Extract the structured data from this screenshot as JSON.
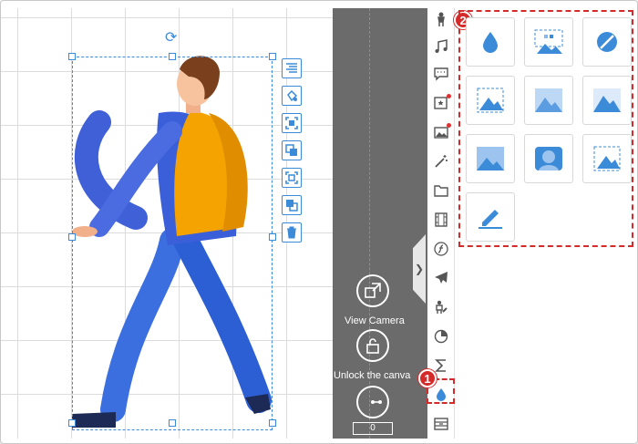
{
  "colors": {
    "accent": "#3c8bd9",
    "callout": "#d42a2a",
    "dark_panel": "#6b6b6b"
  },
  "canvas": {
    "figure": "walking-man-character",
    "object_toolbar": [
      {
        "name": "align-icon"
      },
      {
        "name": "fill-color-icon"
      },
      {
        "name": "crop-icon"
      },
      {
        "name": "copy-style-icon"
      },
      {
        "name": "fit-icon"
      },
      {
        "name": "layer-icon"
      },
      {
        "name": "delete-icon"
      }
    ]
  },
  "camera_panel": {
    "view_camera_label": "View Camera",
    "unlock_canvas_label": "Unlock the canva",
    "counter_value": "0"
  },
  "sidebar": {
    "items": [
      {
        "name": "character-icon"
      },
      {
        "name": "music-icon"
      },
      {
        "name": "speech-bubble-icon"
      },
      {
        "name": "sticker-icon"
      },
      {
        "name": "image-icon"
      },
      {
        "name": "magic-wand-icon"
      },
      {
        "name": "folder-icon"
      },
      {
        "name": "film-icon"
      },
      {
        "name": "formula-icon"
      },
      {
        "name": "airplane-icon"
      },
      {
        "name": "edit-person-icon"
      },
      {
        "name": "pie-chart-icon"
      },
      {
        "name": "sigma-icon"
      },
      {
        "name": "water-drop-icon"
      },
      {
        "name": "archive-icon"
      }
    ],
    "active_index": 13
  },
  "callouts": {
    "first": "1",
    "second": "2"
  },
  "effects_panel": {
    "effects": [
      {
        "name": "water-drop-effect-icon"
      },
      {
        "name": "mosaic-selection-effect-icon"
      },
      {
        "name": "no-fill-effect-icon"
      },
      {
        "name": "selection-mountain-effect-icon"
      },
      {
        "name": "noise-mountain-effect-icon"
      },
      {
        "name": "gradient-mountain-effect-icon"
      },
      {
        "name": "blur-rectangle-effect-icon"
      },
      {
        "name": "blur-shape-effect-icon"
      },
      {
        "name": "transform-mountain-effect-icon"
      },
      {
        "name": "brush-effect-icon"
      }
    ]
  }
}
